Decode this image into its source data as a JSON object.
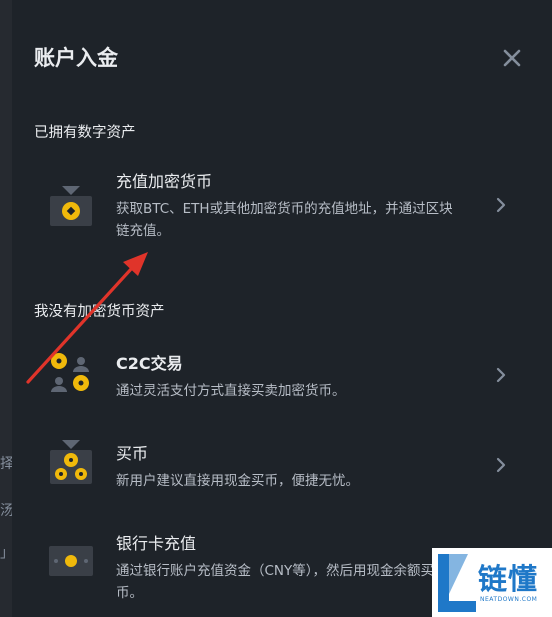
{
  "modal": {
    "title": "账户入金"
  },
  "section_crypto": {
    "title": "已拥有数字资产",
    "options": [
      {
        "label": "充值加密货币",
        "description": "获取BTC、ETH或其他加密货币的充值地址，并通过区块链充值。",
        "icon": "deposit-crypto-icon"
      }
    ]
  },
  "section_no_crypto": {
    "title": "我没有加密货币资产",
    "options": [
      {
        "label": "C2C交易",
        "description": "通过灵活支付方式直接买卖加密货币。",
        "icon": "c2c-trade-icon"
      },
      {
        "label": "买币",
        "description": "新用户建议直接用现金买币，便捷无忧。",
        "icon": "buy-crypto-icon"
      },
      {
        "label": "银行卡充值",
        "description": "通过银行账户充值资金（CNY等），然后用现金余额买币。",
        "icon": "bank-card-icon"
      }
    ]
  },
  "background_chars": [
    "择",
    "汤",
    "」"
  ],
  "watermark": {
    "text": "链懂",
    "subtext": "NEATDOWN.COM",
    "color": "#1f78c8"
  },
  "colors": {
    "accent": "#f0b90b",
    "annotation_arrow": "#e0342a"
  }
}
